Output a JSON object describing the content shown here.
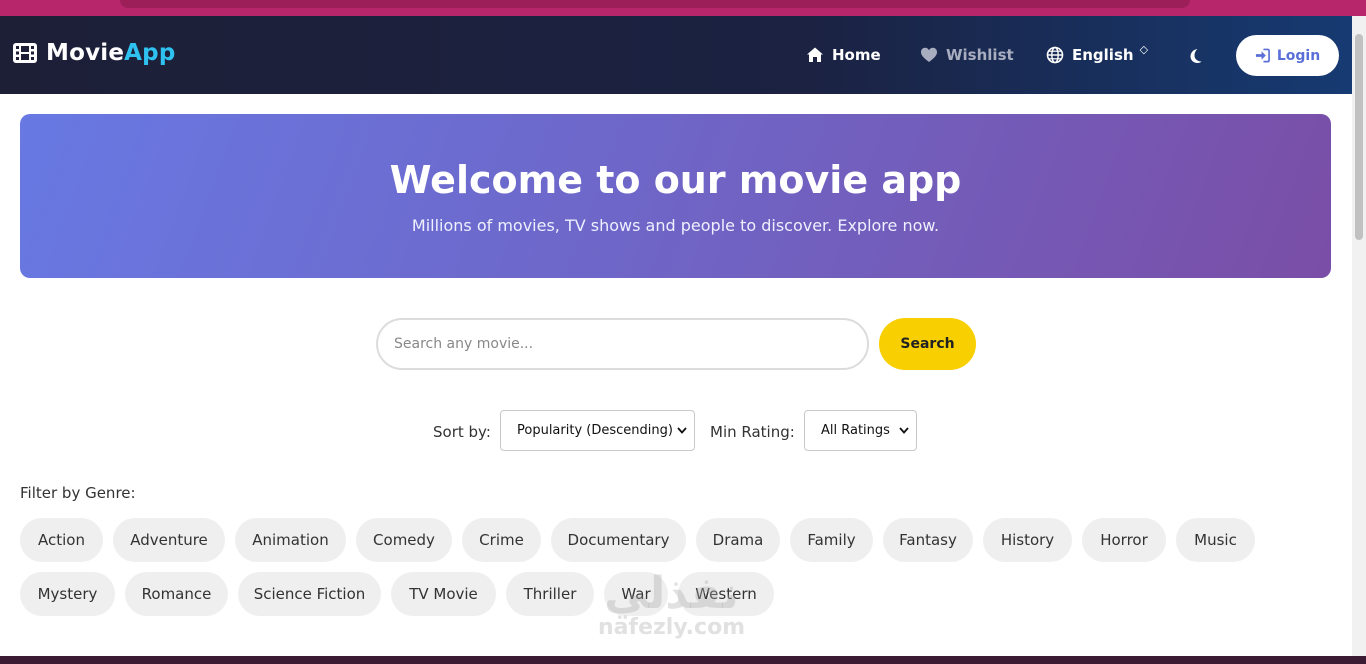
{
  "brand": {
    "name_part1": "Movie",
    "name_part2": "App"
  },
  "nav": {
    "home": "Home",
    "wishlist": "Wishlist",
    "language": "English",
    "login": "Login"
  },
  "hero": {
    "title": "Welcome to our movie app",
    "subtitle": "Millions of movies, TV shows and people to discover. Explore now."
  },
  "search": {
    "placeholder": "Search any movie...",
    "value": "",
    "button": "Search"
  },
  "sort": {
    "label": "Sort by:",
    "selected": "Popularity (Descending)"
  },
  "rating": {
    "label": "Min Rating:",
    "selected": "All Ratings"
  },
  "genres": {
    "label": "Filter by Genre:",
    "items": [
      "Action",
      "Adventure",
      "Animation",
      "Comedy",
      "Crime",
      "Documentary",
      "Drama",
      "Family",
      "Fantasy",
      "History",
      "Horror",
      "Music",
      "Mystery",
      "Romance",
      "Science Fiction",
      "TV Movie",
      "Thriller",
      "War",
      "Western"
    ]
  },
  "watermark": {
    "line1": "نفذلي",
    "line2": "nafezly.com"
  },
  "colors": {
    "nav_bg": "#1c1f36",
    "brand_accent": "#2fc1f0",
    "hero_start": "#6879e3",
    "hero_end": "#7a4ea6",
    "search_button": "#f8cf00",
    "login_text": "#5a70d8",
    "chip_bg": "#efefef"
  },
  "icons": {
    "brand": "film-icon",
    "home": "home-icon",
    "wishlist": "heart-icon",
    "language": "globe-icon",
    "theme": "moon-icon",
    "login": "sign-in-icon"
  }
}
